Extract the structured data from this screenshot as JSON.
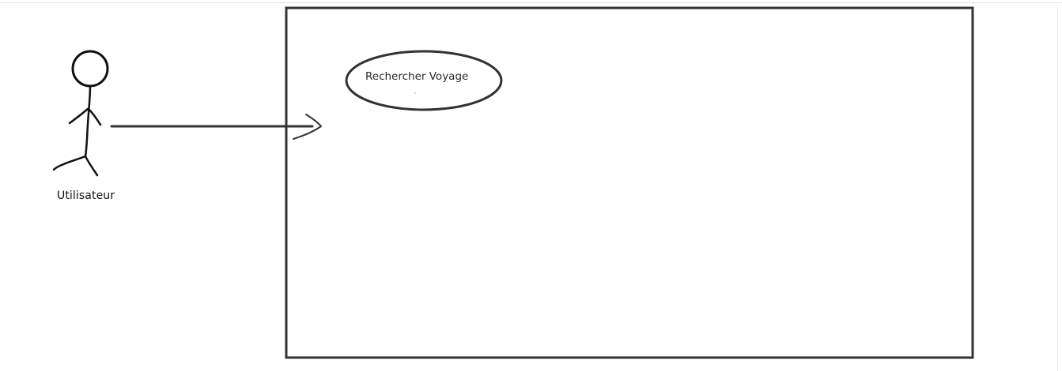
{
  "diagram": {
    "actor": {
      "name": "Utilisateur",
      "icon": "stick-figure-icon"
    },
    "system_boundary": {
      "label": ""
    },
    "use_cases": [
      {
        "label": "Rechercher Voyage"
      }
    ],
    "association": {
      "from": "Utilisateur",
      "to": "system-boundary",
      "arrowhead": "open"
    }
  },
  "colors": {
    "stroke": "#333333",
    "actor_stroke": "#111111",
    "background": "#ffffff"
  }
}
